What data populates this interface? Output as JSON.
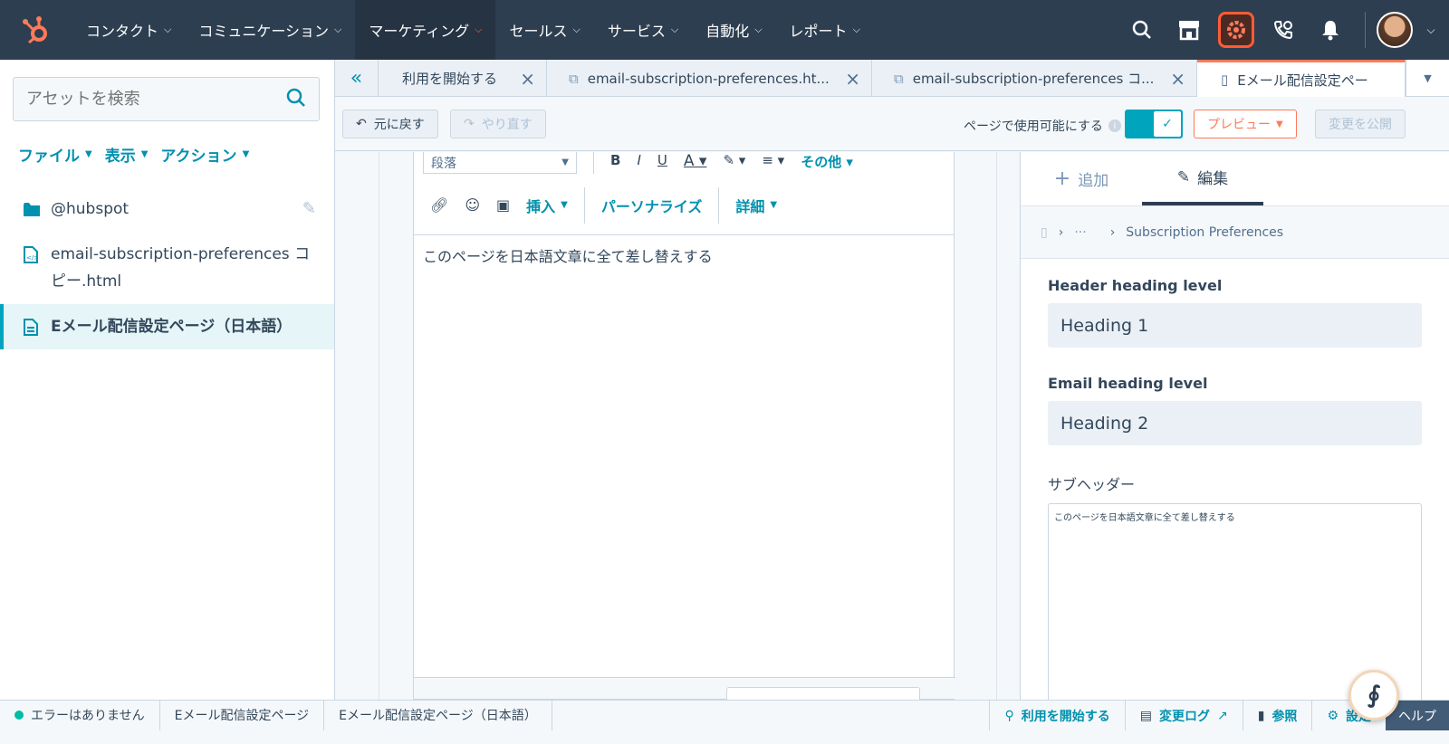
{
  "topnav": {
    "items": [
      {
        "label": "コンタクト"
      },
      {
        "label": "コミュニケーション"
      },
      {
        "label": "マーケティング"
      },
      {
        "label": "セールス"
      },
      {
        "label": "サービス"
      },
      {
        "label": "自動化"
      },
      {
        "label": "レポート"
      }
    ],
    "icons": [
      "search-icon",
      "marketplace-icon",
      "settings-icon",
      "calling-icon",
      "notifications-icon"
    ]
  },
  "sidebar": {
    "search_placeholder": "アセットを検索",
    "menu": [
      {
        "label": "ファイル"
      },
      {
        "label": "表示"
      },
      {
        "label": "アクション"
      }
    ],
    "tree": [
      {
        "label": "@hubspot"
      },
      {
        "label": "email-subscription-preferences コピー.html"
      },
      {
        "label": "Eメール配信設定ページ（日本語）"
      }
    ]
  },
  "tabs": [
    {
      "label": "利用を開始する"
    },
    {
      "label": "email-subscription-preferences.ht..."
    },
    {
      "label": "email-subscription-preferences コ..."
    },
    {
      "label": "Eメール配信設定ペー"
    }
  ],
  "toolbar": {
    "undo": "元に戻す",
    "redo": "やり直す",
    "toggle_label": "ページで使用可能にする",
    "preview": "プレビュー",
    "publish": "変更を公開"
  },
  "editor": {
    "paragraph_select": "段落",
    "more": "その他",
    "insert": "挿入",
    "personalize": "パーソナライズ",
    "details": "詳細",
    "content": "このページを日本語文章に全て差し替えする"
  },
  "panel": {
    "tab_add": "追加",
    "tab_edit": "編集",
    "breadcrumb_ellipsis": "···",
    "breadcrumb": "Subscription Preferences",
    "header_heading_label": "Header heading level",
    "header_heading_value": "Heading 1",
    "email_heading_label": "Email heading level",
    "email_heading_value": "Heading 2",
    "subheader_label": "サブヘッダー",
    "subheader_value": "このページを日本語文章に全て差し替えする"
  },
  "statusbar": {
    "errors": "エラーはありません",
    "crumb1": "Eメール配信設定ページ",
    "crumb2": "Eメール配信設定ページ（日本語）",
    "getting_started": "利用を開始する",
    "changelog": "変更ログ",
    "reference": "参照",
    "settings": "設定",
    "help": "ヘルプ"
  }
}
